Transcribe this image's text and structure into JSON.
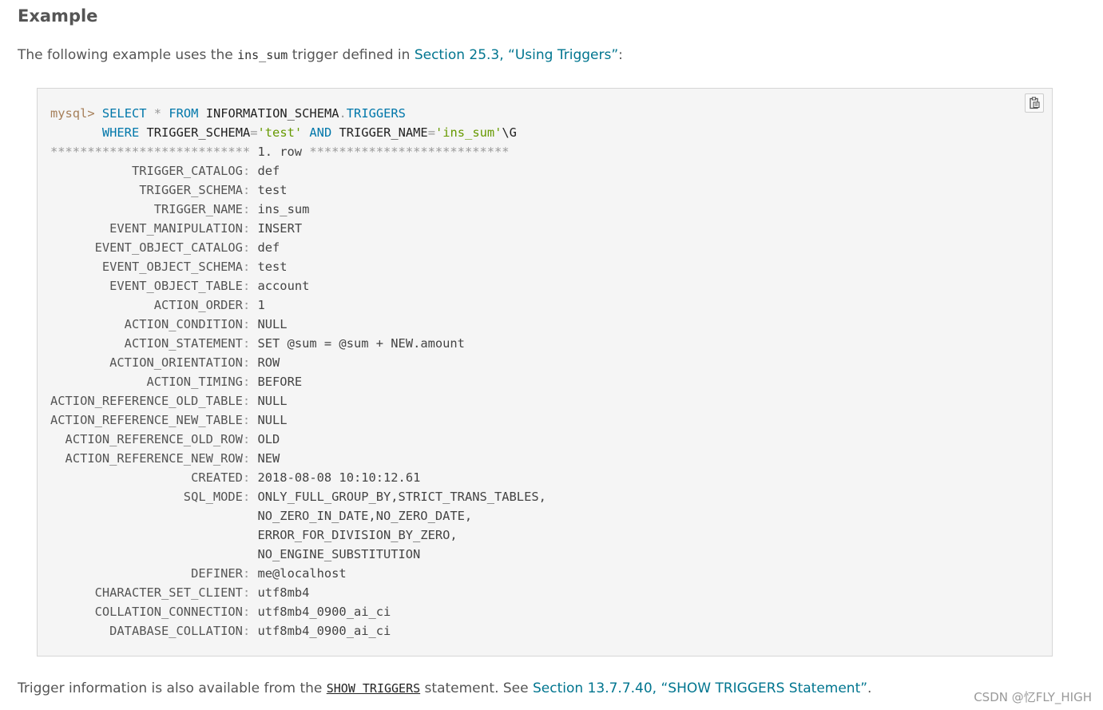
{
  "heading": "Example",
  "intro": {
    "before": "The following example uses the ",
    "code": "ins_sum",
    "middle": " trigger defined in ",
    "link": "Section 25.3, “Using Triggers”",
    "after": ":"
  },
  "query": {
    "prompt": "mysql>",
    "select": "SELECT",
    "star": "*",
    "from": "FROM",
    "schema": "INFORMATION_SCHEMA",
    "dot": ".",
    "table": "TRIGGERS",
    "where": "WHERE",
    "col1": "TRIGGER_SCHEMA",
    "eq1": "=",
    "val1": "'test'",
    "and": "AND",
    "col2": "TRIGGER_NAME",
    "eq2": "=",
    "val2": "'ins_sum'",
    "terminator": "\\G"
  },
  "row_header": {
    "stars_left": "***************************",
    "label": "1. row",
    "stars_right": "***************************"
  },
  "rows": [
    {
      "name": "TRIGGER_CATALOG",
      "value": "def"
    },
    {
      "name": "TRIGGER_SCHEMA",
      "value": "test"
    },
    {
      "name": "TRIGGER_NAME",
      "value": "ins_sum"
    },
    {
      "name": "EVENT_MANIPULATION",
      "value": "INSERT"
    },
    {
      "name": "EVENT_OBJECT_CATALOG",
      "value": "def"
    },
    {
      "name": "EVENT_OBJECT_SCHEMA",
      "value": "test"
    },
    {
      "name": "EVENT_OBJECT_TABLE",
      "value": "account"
    },
    {
      "name": "ACTION_ORDER",
      "value": "1"
    },
    {
      "name": "ACTION_CONDITION",
      "value": "NULL"
    },
    {
      "name": "ACTION_STATEMENT",
      "value": "SET @sum = @sum + NEW.amount"
    },
    {
      "name": "ACTION_ORIENTATION",
      "value": "ROW"
    },
    {
      "name": "ACTION_TIMING",
      "value": "BEFORE"
    },
    {
      "name": "ACTION_REFERENCE_OLD_TABLE",
      "value": "NULL"
    },
    {
      "name": "ACTION_REFERENCE_NEW_TABLE",
      "value": "NULL"
    },
    {
      "name": "ACTION_REFERENCE_OLD_ROW",
      "value": "OLD"
    },
    {
      "name": "ACTION_REFERENCE_NEW_ROW",
      "value": "NEW"
    },
    {
      "name": "CREATED",
      "value": "2018-08-08 10:10:12.61"
    },
    {
      "name": "SQL_MODE",
      "value": "ONLY_FULL_GROUP_BY,STRICT_TRANS_TABLES,\nNO_ZERO_IN_DATE,NO_ZERO_DATE,\nERROR_FOR_DIVISION_BY_ZERO,\nNO_ENGINE_SUBSTITUTION"
    },
    {
      "name": "DEFINER",
      "value": "me@localhost"
    },
    {
      "name": "CHARACTER_SET_CLIENT",
      "value": "utf8mb4"
    },
    {
      "name": "COLLATION_CONNECTION",
      "value": "utf8mb4_0900_ai_ci"
    },
    {
      "name": "DATABASE_COLLATION",
      "value": "utf8mb4_0900_ai_ci"
    }
  ],
  "separator": ":",
  "outro": {
    "before": "Trigger information is also available from the ",
    "code": "SHOW TRIGGERS",
    "middle": " statement. See ",
    "link": "Section 13.7.7.40, “SHOW TRIGGERS Statement”",
    "after": "."
  },
  "copy_button_icon": "clipboard-icon",
  "watermark": "CSDN @忆FLY_HIGH"
}
